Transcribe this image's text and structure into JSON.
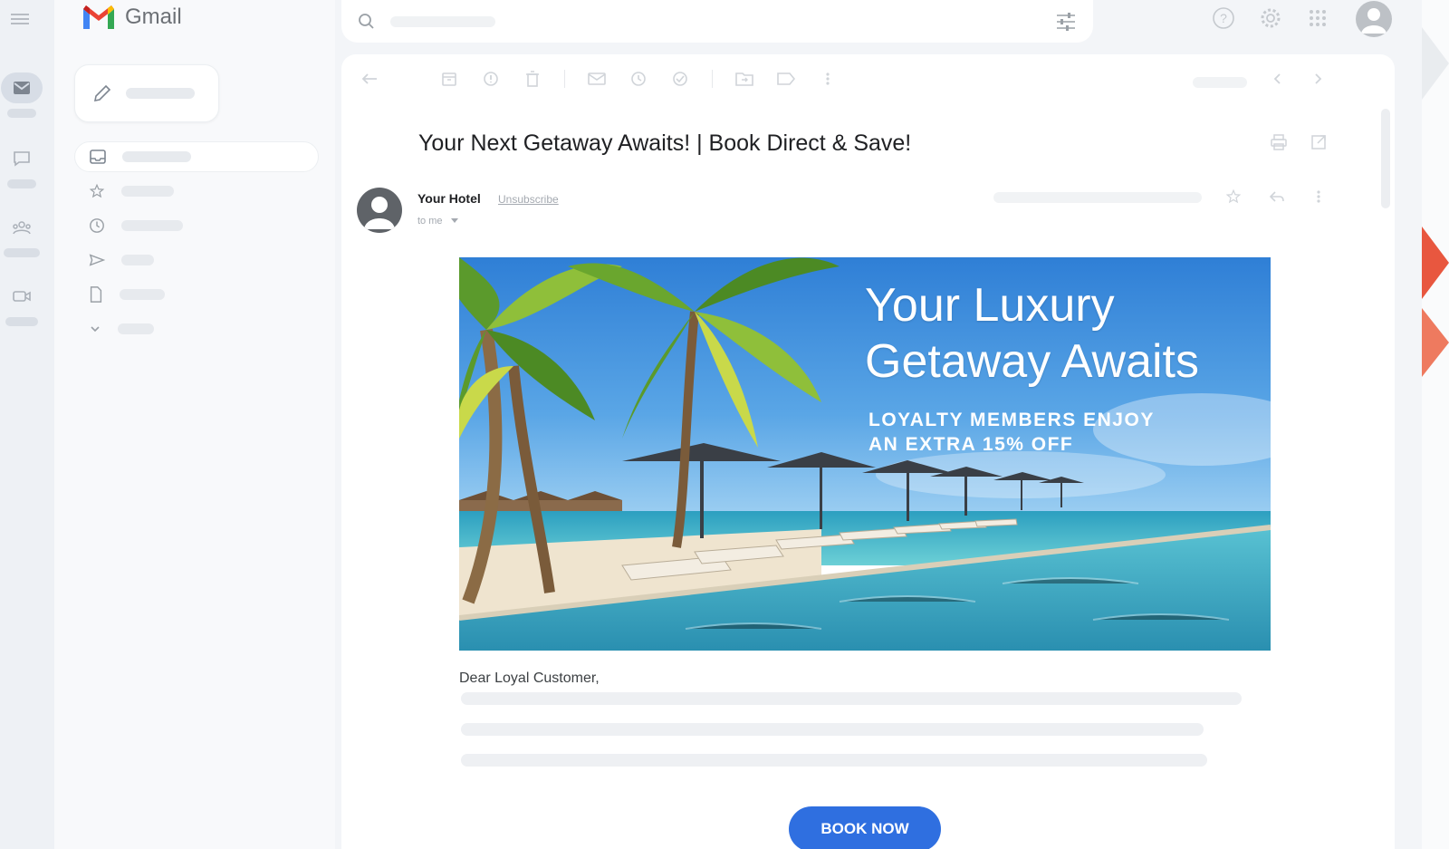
{
  "app": {
    "name": "Gmail"
  },
  "colors": {
    "accent": "#2f6fe0",
    "brand_red": "#ea4335",
    "brand_blue": "#4285f4",
    "brand_yellow": "#fbbc04",
    "brand_green": "#34a853"
  },
  "icons": {
    "rail": [
      "mail-icon",
      "chat-icon",
      "spaces-icon",
      "meet-icon"
    ],
    "nav": [
      "inbox-icon",
      "star-icon",
      "clock-icon",
      "send-icon",
      "draft-icon",
      "chevron-down-icon"
    ],
    "toolbar": [
      "back-arrow-icon",
      "archive-icon",
      "report-spam-icon",
      "delete-icon",
      "mark-unread-icon",
      "snooze-icon",
      "add-task-icon",
      "move-to-icon",
      "label-icon",
      "more-vert-icon"
    ],
    "top": [
      "help-icon",
      "settings-icon",
      "apps-grid-icon",
      "account-avatar-icon"
    ]
  },
  "email": {
    "subject": "Your Next Getaway Awaits! | Book Direct & Save!",
    "sender_name": "Your Hotel",
    "unsubscribe_label": "Unsubscribe",
    "recipient_label": "to me",
    "hero": {
      "title_line1": "Your Luxury",
      "title_line2": "Getaway Awaits",
      "subtitle_line1": "LOYALTY MEMBERS ENJOY",
      "subtitle_line2": "AN EXTRA 15% OFF"
    },
    "greeting": "Dear Loyal Customer,",
    "cta_label": "BOOK NOW"
  }
}
